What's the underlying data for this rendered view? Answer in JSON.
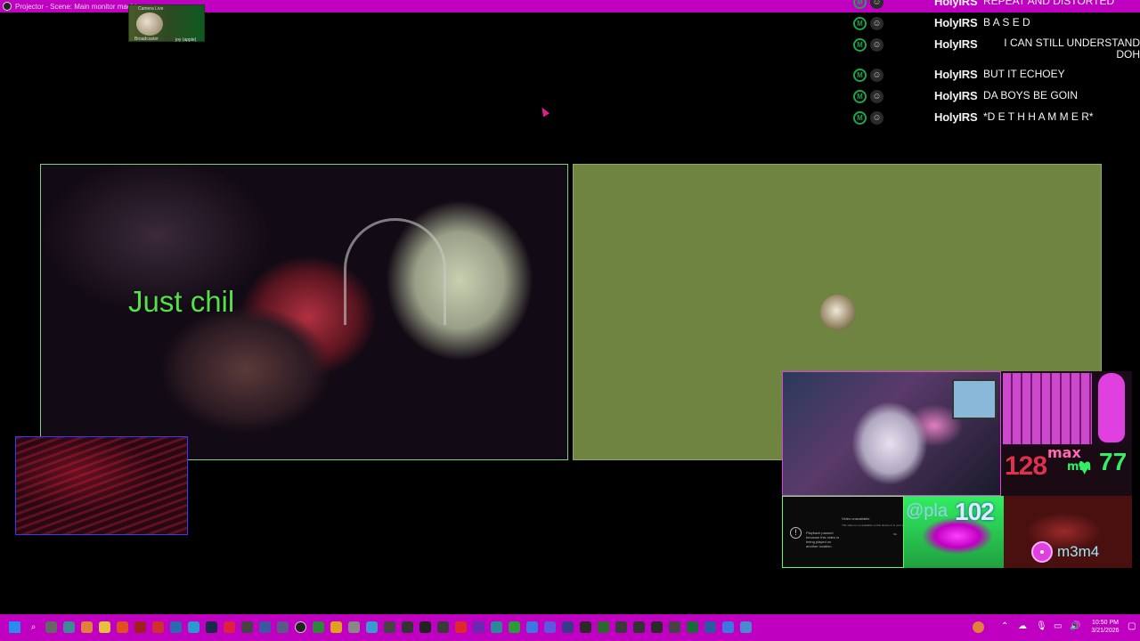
{
  "window": {
    "title": "Projector - Scene: Main monitor machine"
  },
  "thumbnail": {
    "label_top": "Camera Live",
    "label_left": "Broadcaster",
    "label_right": "joy (apple)"
  },
  "chat": {
    "messages": [
      {
        "user": "HolyIRS",
        "text": "REPEAT AND DISTORTED"
      },
      {
        "user": "HolyIRS",
        "text": "B A S E D"
      },
      {
        "user": "HolyIRS",
        "text": "I CAN STILL UNDERSTAND DOH"
      },
      {
        "user": "HolyIRS",
        "text": "BUT IT ECHOEY"
      },
      {
        "user": "HolyIRS",
        "text": "DA BOYS BE GOIN"
      },
      {
        "user": "HolyIRS",
        "text": "*D E T H H A M M E R*"
      }
    ],
    "badge_mod": "M",
    "badge_user": "☺",
    "accent_color": "#1aa84a"
  },
  "webcam": {
    "overlay_text": "Just chil"
  },
  "heart_rate": {
    "current": "128",
    "max_label": "max",
    "min_label": "min",
    "min_value": "77"
  },
  "notification": {
    "title": "Video unavailable",
    "subtitle": "This video is not available on this device or in your location.",
    "message": "Playback paused because this video is being played on another location.",
    "action": "Ok"
  },
  "social": {
    "handle": "@pla",
    "count": "102",
    "track": "m3m4"
  },
  "taskbar": {
    "time": "10:50 PM",
    "date": "3/21/2026",
    "start_icon": "windows-start-icon",
    "color": "#c000c0"
  }
}
